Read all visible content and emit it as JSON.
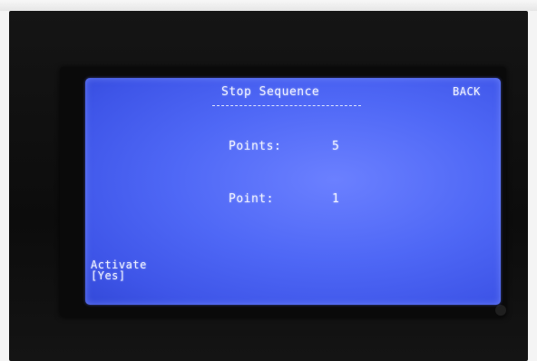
{
  "screen": {
    "title": "Stop Sequence",
    "back_label": "BACK",
    "points_label": "Points:",
    "points_value": "5",
    "point_label": "Point:",
    "point_value": "1",
    "activate_label": "Activate",
    "activate_value": "[Yes]"
  },
  "colors": {
    "screen_background": "#4f68f6",
    "screen_text": "#eef1ff",
    "bezel": "#0c0c0c"
  }
}
